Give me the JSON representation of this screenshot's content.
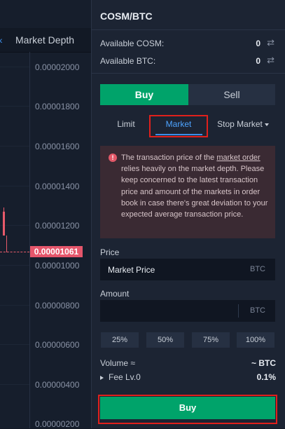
{
  "chart": {
    "tabs": [
      "Market Depth"
    ],
    "y_ticks": [
      "0.00002000",
      "0.00001800",
      "0.00001600",
      "0.00001400",
      "0.00001200",
      "0.00001000",
      "0.00000800",
      "0.00000600",
      "0.00000400",
      "0.00000200"
    ],
    "last_price": "0.00001061",
    "colors": {
      "down": "#e85a6a"
    }
  },
  "header": {
    "pair": "COSM/BTC"
  },
  "balances": [
    {
      "label": "Available COSM:",
      "value": "0"
    },
    {
      "label": "Available BTC:",
      "value": "0"
    }
  ],
  "side_tabs": {
    "buy": "Buy",
    "sell": "Sell"
  },
  "order_types": {
    "limit": "Limit",
    "market": "Market",
    "stop": "Stop Market"
  },
  "warning": {
    "prefix": "The transaction price of the ",
    "link": "market order",
    "suffix": " relies heavily on the market depth. Please keep concerned to the latest transaction price and amount of the markets in order book in case there's great deviation to your expected average transaction price."
  },
  "price": {
    "label": "Price",
    "value": "Market Price",
    "unit": "BTC"
  },
  "amount": {
    "label": "Amount",
    "value": "",
    "unit": "BTC"
  },
  "percent_buttons": [
    "25%",
    "50%",
    "75%",
    "100%"
  ],
  "volume": {
    "label": "Volume ≈",
    "value": "~ BTC"
  },
  "fee": {
    "label": "Fee  Lv.0",
    "value": "0.1%"
  },
  "submit": {
    "label": "Buy"
  },
  "colors": {
    "buy": "#00a36a",
    "sell_red": "#e5566b",
    "accent": "#3d8ee8",
    "highlight_box": "#e0201c"
  }
}
